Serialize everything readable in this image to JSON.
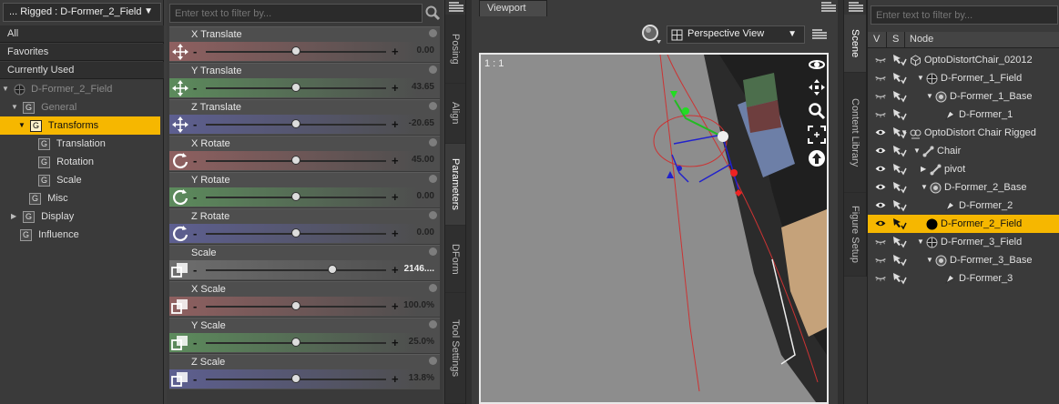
{
  "left_panel": {
    "node_selector": "... Rigged : D-Former_2_Field",
    "categories": [
      "All",
      "Favorites",
      "Currently Used"
    ],
    "tree": [
      {
        "label": "D-Former_2_Field",
        "dim": true
      },
      {
        "label": "General",
        "dim": true
      },
      {
        "label": "Transforms",
        "selected": true
      },
      {
        "label": "Translation"
      },
      {
        "label": "Rotation"
      },
      {
        "label": "Scale"
      },
      {
        "label": "Misc"
      },
      {
        "label": "Display"
      },
      {
        "label": "Influence"
      }
    ],
    "group_glyph": "G"
  },
  "parameters": {
    "filter_placeholder": "Enter text to filter by...",
    "items": [
      {
        "label": "X Translate",
        "value": "0.00",
        "fraction": 0.5,
        "color": "#8f6060",
        "icon": "move-icon"
      },
      {
        "label": "Y Translate",
        "value": "43.65",
        "fraction": 0.5,
        "color": "#5c8b5c",
        "icon": "move-icon"
      },
      {
        "label": "Z Translate",
        "value": "-20.65",
        "fraction": 0.5,
        "color": "#5d5f91",
        "icon": "move-icon"
      },
      {
        "label": "X Rotate",
        "value": "45.00",
        "fraction": 0.5,
        "color": "#8f6060",
        "icon": "rotate-icon"
      },
      {
        "label": "Y Rotate",
        "value": "0.00",
        "fraction": 0.5,
        "color": "#5c8b5c",
        "icon": "rotate-icon"
      },
      {
        "label": "Z Rotate",
        "value": "0.00",
        "fraction": 0.5,
        "color": "#5d5f91",
        "icon": "rotate-icon"
      },
      {
        "label": "Scale",
        "value": "2146....",
        "fraction": 0.7,
        "color": "#6e6e6e",
        "icon": "scale-icon",
        "dark_value": true
      },
      {
        "label": "X Scale",
        "value": "100.0%",
        "fraction": 0.5,
        "color": "#8f6060",
        "icon": "scale-icon"
      },
      {
        "label": "Y Scale",
        "value": "25.0%",
        "fraction": 0.5,
        "color": "#5c8b5c",
        "icon": "scale-icon"
      },
      {
        "label": "Z Scale",
        "value": "13.8%",
        "fraction": 0.5,
        "color": "#5d5f91",
        "icon": "scale-icon"
      }
    ]
  },
  "pane_tabs": [
    "Posing",
    "Align",
    "Parameters",
    "DForm",
    "Tool Settings"
  ],
  "active_pane_tab": "Parameters",
  "viewport": {
    "tab": "Viewport",
    "view_select": "Perspective View",
    "ratio": "1 : 1"
  },
  "scene_tabs": [
    "Scene",
    "Content Library",
    "Figure Setup"
  ],
  "active_scene_tab": "Scene",
  "scene": {
    "filter_placeholder": "Enter text to filter by...",
    "columns": {
      "v": "V",
      "s": "S",
      "node": "Node"
    },
    "nodes": [
      {
        "label": "OptoDistortChair_02012",
        "icon": "prop-icon",
        "eye_open": false
      },
      {
        "label": "D-Former_1_Field",
        "icon": "field-icon",
        "eye_open": false
      },
      {
        "label": "D-Former_1_Base",
        "icon": "base-icon",
        "eye_open": false
      },
      {
        "label": "D-Former_1",
        "icon": "dformer-icon",
        "eye_open": false
      },
      {
        "label": "OptoDistort Chair Rigged",
        "icon": "figure-icon",
        "eye_open": true
      },
      {
        "label": "Chair",
        "icon": "bone-icon",
        "eye_open": true
      },
      {
        "label": "pivot",
        "icon": "bone-icon",
        "eye_open": true
      },
      {
        "label": "D-Former_2_Base",
        "icon": "base-icon",
        "eye_open": true
      },
      {
        "label": "D-Former_2",
        "icon": "dformer-icon",
        "eye_open": true
      },
      {
        "label": "D-Former_2_Field",
        "icon": "field-icon",
        "eye_open": true,
        "selected": true
      },
      {
        "label": "D-Former_3_Field",
        "icon": "field-icon",
        "eye_open": false
      },
      {
        "label": "D-Former_3_Base",
        "icon": "base-icon",
        "eye_open": false
      },
      {
        "label": "D-Former_3",
        "icon": "dformer-icon",
        "eye_open": false
      }
    ]
  },
  "colors": {
    "selection": "#f6b700",
    "panel": "#3a3a3a",
    "viewport_bg": "#8e8e8e"
  }
}
